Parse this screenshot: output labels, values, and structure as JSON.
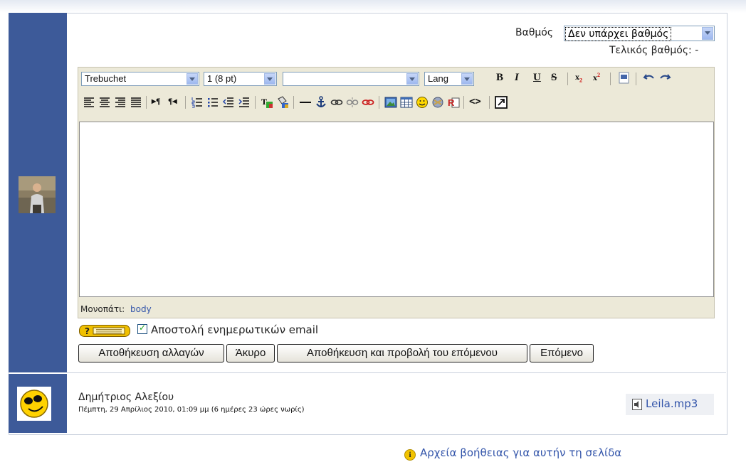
{
  "grading": {
    "grade_label": "Βαθμός",
    "grade_value": "Δεν υπάρχει βαθμός",
    "final_grade": "Τελικός βαθμός: -"
  },
  "editor": {
    "font_family": "Trebuchet",
    "font_size": "1 (8 pt)",
    "heading_value": "",
    "lang": "Lang",
    "path_label": "Μονοπάτι:",
    "path_value": "body",
    "toolbar_row1_icons": [
      "bold-icon",
      "italic-icon",
      "underline-icon",
      "strikethrough-icon",
      "subscript-icon",
      "superscript-icon",
      "clean-word-icon",
      "undo-icon",
      "redo-icon"
    ],
    "toolbar_row2_icons": [
      "align-left-icon",
      "align-center-icon",
      "align-right-icon",
      "justify-icon",
      "ltr-icon",
      "rtl-icon",
      "ordered-list-icon",
      "unordered-list-icon",
      "outdent-icon",
      "indent-icon",
      "text-color-icon",
      "background-color-icon",
      "horizontal-rule-icon",
      "anchor-icon",
      "link-icon",
      "unlink-icon",
      "nolink-icon",
      "image-icon",
      "table-icon",
      "smiley-icon",
      "special-char-icon",
      "search-replace-icon",
      "html-source-icon",
      "fullscreen-icon"
    ]
  },
  "notify": {
    "checkbox_label": "Αποστολή ενημερωτικών email",
    "checked": true
  },
  "buttons": {
    "save": "Αποθήκευση αλλαγών",
    "cancel": "Άκυρο",
    "save_next": "Αποθήκευση και προβολή του επόμενου",
    "next": "Επόμενο"
  },
  "submission": {
    "student_name": "Δημήτριος Αλεξίου",
    "date": "Πέμπτη, 29 Απρίλιος 2010, 01:09 μμ (6 ημέρες 23 ώρες νωρίς)",
    "file_name": "Leila.mp3"
  },
  "footer": {
    "help_link": "Αρχεία βοήθειας για αυτήν τη σελίδα"
  },
  "colors": {
    "sidebar_blue": "#3d5a99",
    "link_blue": "#3355aa",
    "toolbar_bg": "#ece9d8"
  }
}
